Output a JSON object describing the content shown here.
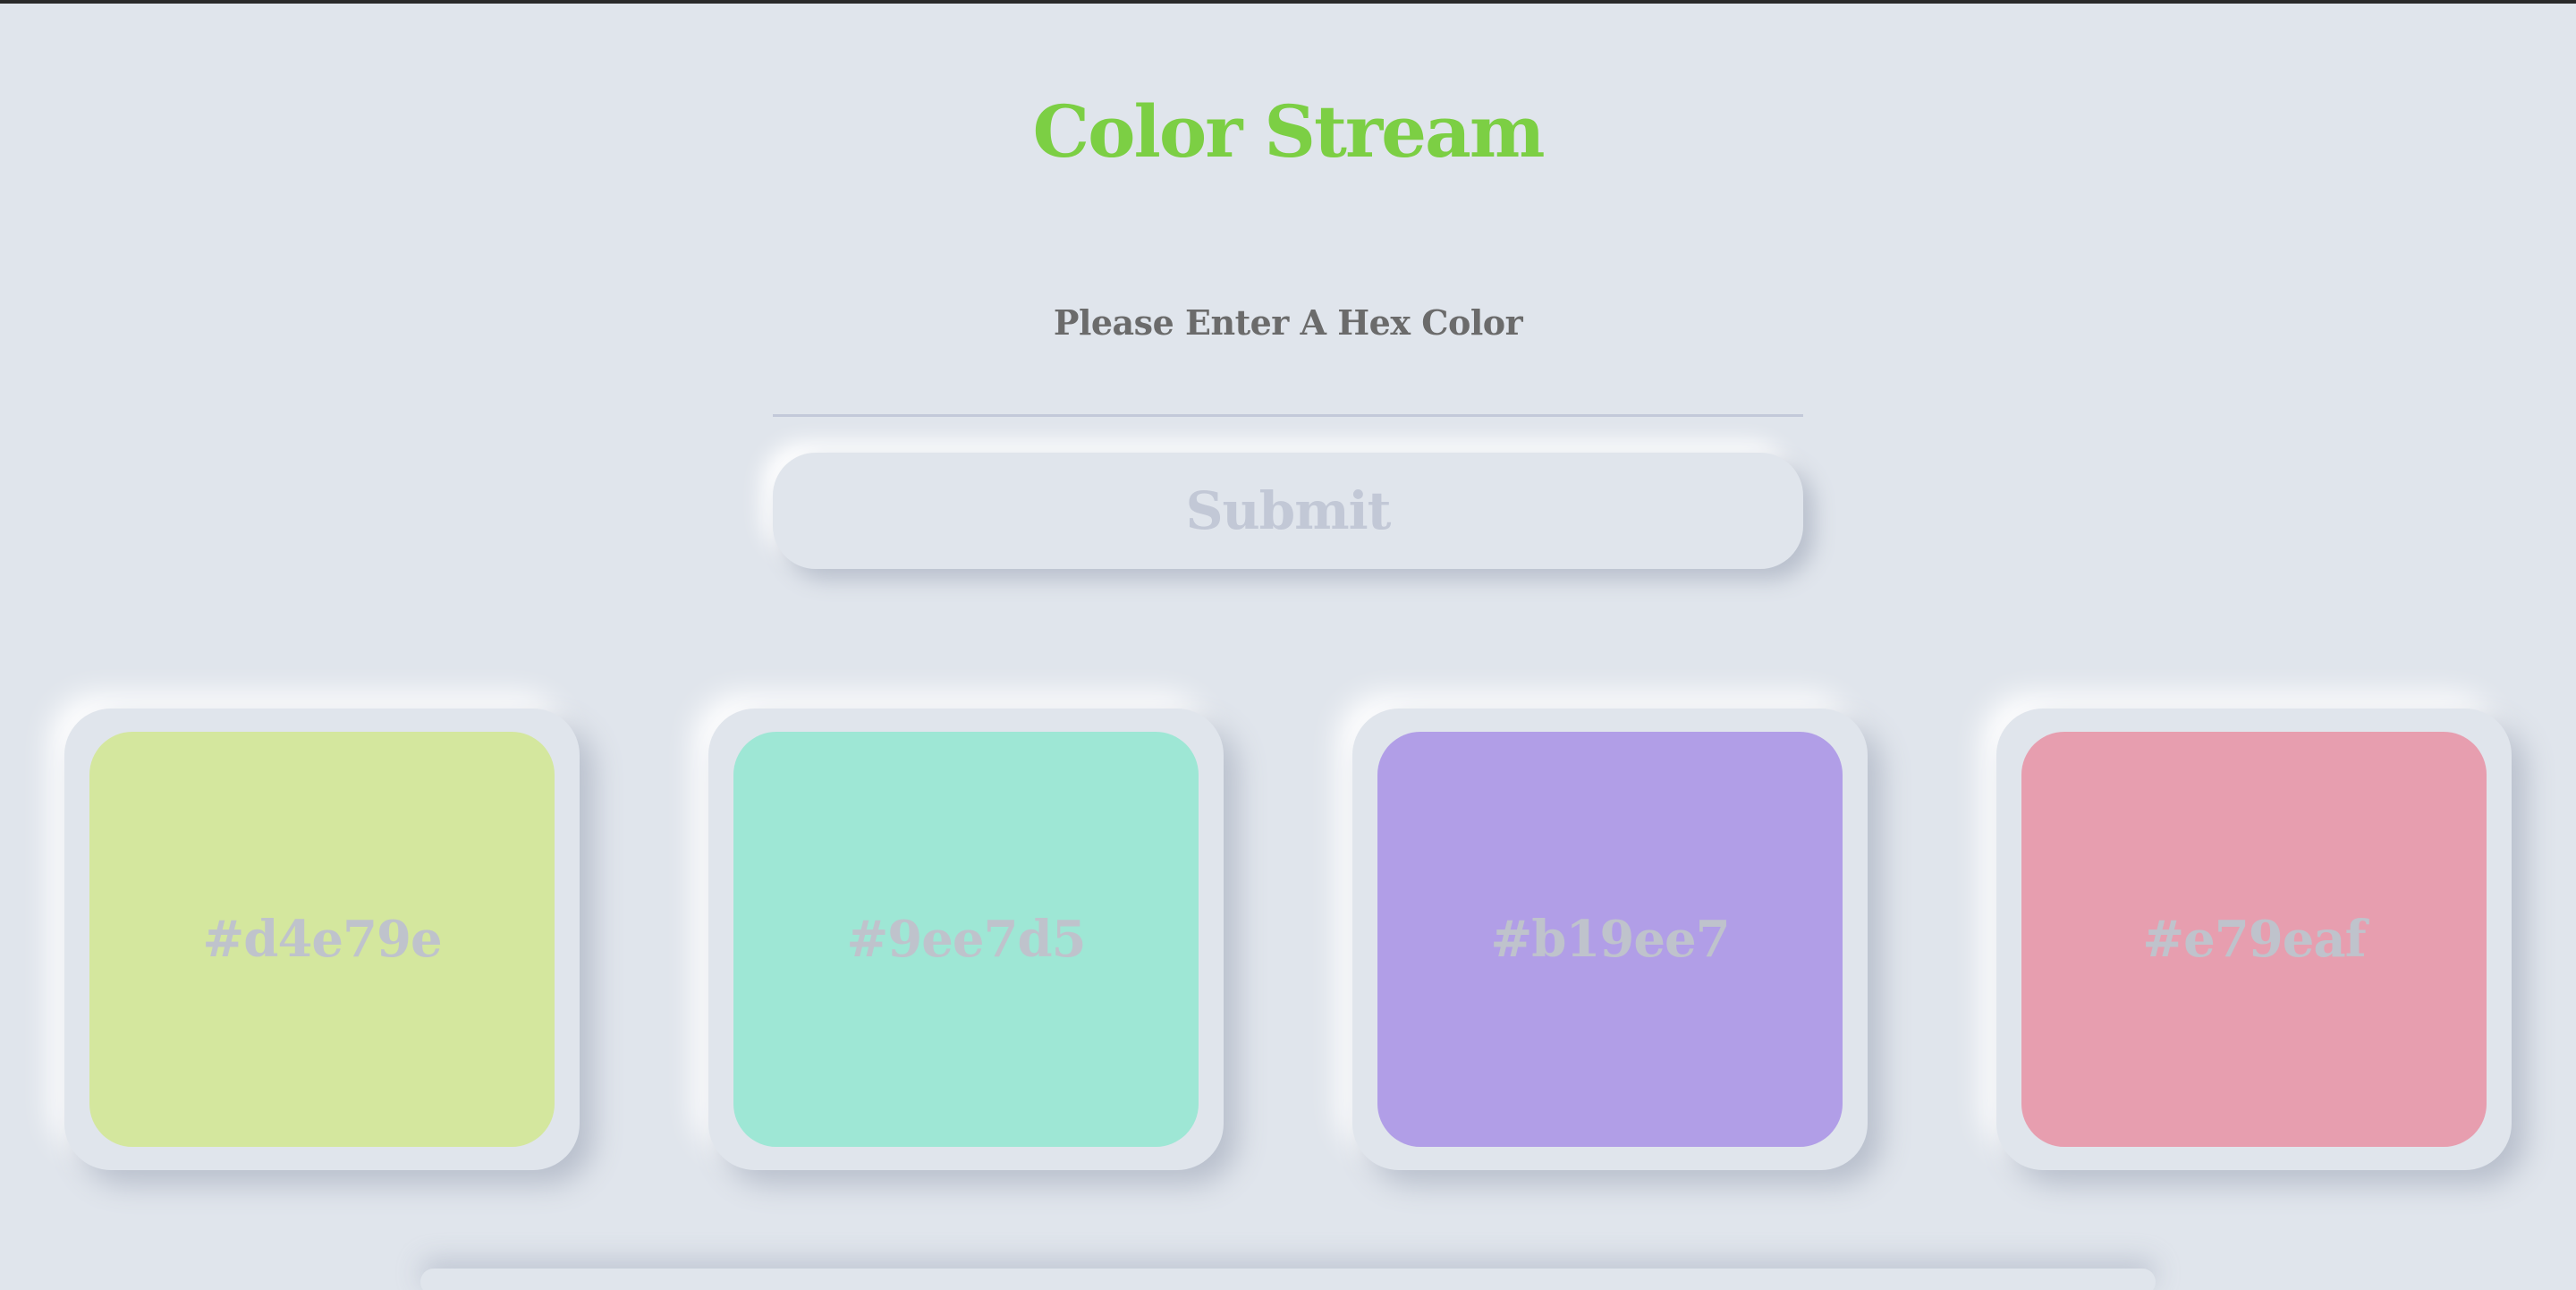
{
  "app": {
    "title": "Color Stream"
  },
  "form": {
    "prompt": "Please Enter A Hex Color",
    "input_value": "",
    "submit_label": "Submit"
  },
  "colors": {
    "accent_title": "#7ccf44",
    "background": "#e0e5ec"
  },
  "swatches": [
    {
      "hex": "#d4e79e",
      "label": "#d4e79e"
    },
    {
      "hex": "#9ee7d5",
      "label": "#9ee7d5"
    },
    {
      "hex": "#b19ee7",
      "label": "#b19ee7"
    },
    {
      "hex": "#e79eaf",
      "label": "#e79eaf"
    }
  ]
}
